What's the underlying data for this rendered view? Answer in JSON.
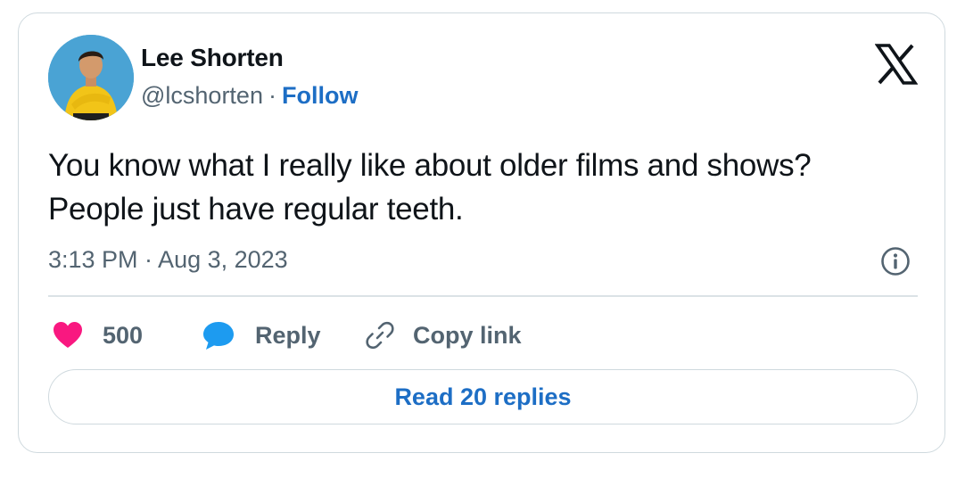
{
  "author": {
    "name": "Lee Shorten",
    "handle": "@lcshorten",
    "separator": "·",
    "follow_label": "Follow",
    "avatar_icon": "profile-photo"
  },
  "platform_icon": "x-logo",
  "tweet": {
    "text_line1": "You know what I really like about older films and shows?",
    "text_line2": "People just have regular teeth.",
    "timestamp": "3:13 PM · Aug 3, 2023"
  },
  "actions": {
    "like_count": "500",
    "reply_label": "Reply",
    "copy_link_label": "Copy link"
  },
  "read_replies_label": "Read 20 replies",
  "colors": {
    "accent": "#1d6ec5",
    "heart": "#f91880",
    "reply_bubble": "#1d9bf0",
    "secondary_text": "#536471",
    "border": "#cfd9de"
  }
}
